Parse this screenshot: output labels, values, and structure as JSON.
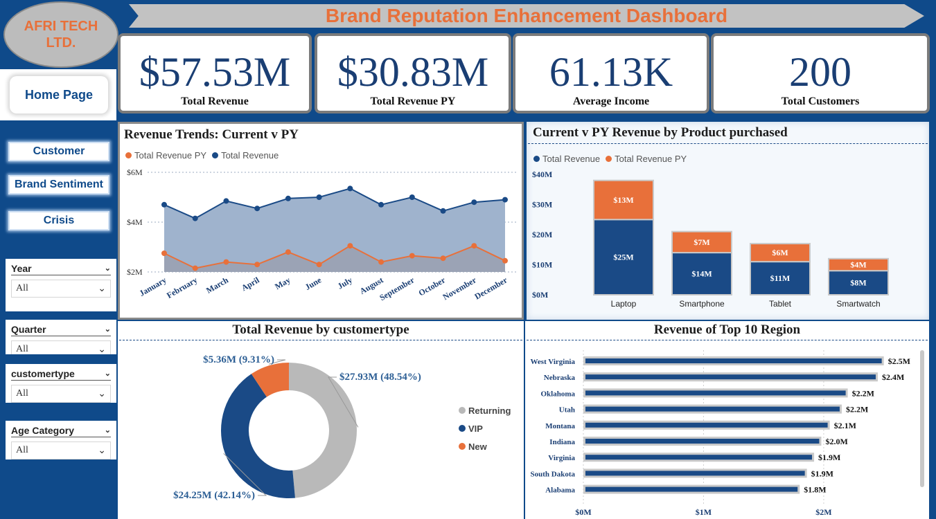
{
  "company": {
    "name_line1": "AFRI TECH",
    "name_line2": "LTD."
  },
  "banner": {
    "title": "Brand Reputation Enhancement Dashboard"
  },
  "nav": {
    "home": "Home Page",
    "customer": "Customer",
    "brand": "Brand Sentiment",
    "crisis": "Crisis"
  },
  "slicers": [
    {
      "title": "Year",
      "value": "All"
    },
    {
      "title": "Quarter",
      "value": "All"
    },
    {
      "title": "customertype",
      "value": "All"
    },
    {
      "title": "Age Category",
      "value": "All"
    }
  ],
  "kpis": [
    {
      "value": "$57.53M",
      "label": "Total Revenue"
    },
    {
      "value": "$30.83M",
      "label": "Total Revenue PY"
    },
    {
      "value": "61.13K",
      "label": "Average Income"
    },
    {
      "value": "200",
      "label": "Total Customers"
    }
  ],
  "colors": {
    "navy": "#1a4a86",
    "orange": "#e8703a",
    "grey": "#b9b9b9",
    "sidebar": "#0f4a8a"
  },
  "chart_data": [
    {
      "type": "area",
      "title": "Revenue Trends: Current v PY",
      "legend": [
        "Total Revenue PY",
        "Total Revenue"
      ],
      "categories": [
        "January",
        "February",
        "March",
        "April",
        "May",
        "June",
        "July",
        "August",
        "September",
        "October",
        "November",
        "December"
      ],
      "y_ticks": [
        "$2M",
        "$4M",
        "$6M"
      ],
      "ylim": [
        2,
        6
      ],
      "series": [
        {
          "name": "Total Revenue",
          "values": [
            4.7,
            4.15,
            4.85,
            4.55,
            4.95,
            5.0,
            5.35,
            4.7,
            5.0,
            4.45,
            4.8,
            4.9
          ]
        },
        {
          "name": "Total Revenue PY",
          "values": [
            2.75,
            2.15,
            2.4,
            2.3,
            2.8,
            2.3,
            3.05,
            2.4,
            2.65,
            2.55,
            3.05,
            2.45
          ]
        }
      ]
    },
    {
      "type": "bar",
      "title": "Current v PY Revenue by Product purchased",
      "legend": [
        "Total Revenue",
        "Total Revenue PY"
      ],
      "categories": [
        "Laptop",
        "Smartphone",
        "Tablet",
        "Smartwatch"
      ],
      "y_ticks": [
        "$0M",
        "$10M",
        "$20M",
        "$30M",
        "$40M"
      ],
      "ylim": [
        0,
        40
      ],
      "series": [
        {
          "name": "Total Revenue",
          "values": [
            25,
            14,
            11,
            8
          ],
          "labels": [
            "$25M",
            "$14M",
            "$11M",
            "$8M"
          ]
        },
        {
          "name": "Total Revenue PY",
          "values": [
            13,
            7,
            6,
            4
          ],
          "labels": [
            "$13M",
            "$7M",
            "$6M",
            "$4M"
          ]
        }
      ]
    },
    {
      "type": "pie",
      "title": "Total Revenue by customertype",
      "labels": [
        "Returning",
        "VIP",
        "New"
      ],
      "values": [
        27.93,
        24.25,
        5.36
      ],
      "percents": [
        48.54,
        42.14,
        9.31
      ],
      "data_labels": [
        "$27.93M (48.54%)",
        "$24.25M (42.14%)",
        "$5.36M (9.31%)"
      ]
    },
    {
      "type": "bar",
      "title": "Revenue of Top 10 Region",
      "categories": [
        "West Virginia",
        "Nebraska",
        "Oklahoma",
        "Utah",
        "Montana",
        "Indiana",
        "Virginia",
        "South Dakota",
        "Alabama"
      ],
      "values": [
        2.5,
        2.45,
        2.2,
        2.15,
        2.05,
        1.98,
        1.92,
        1.86,
        1.8
      ],
      "data_labels": [
        "$2.5M",
        "$2.4M",
        "$2.2M",
        "$2.2M",
        "$2.1M",
        "$2.0M",
        "$1.9M",
        "$1.9M",
        "$1.8M"
      ],
      "x_ticks": [
        "$0M",
        "$1M",
        "$2M"
      ],
      "xlim": [
        0,
        2.6
      ]
    }
  ]
}
